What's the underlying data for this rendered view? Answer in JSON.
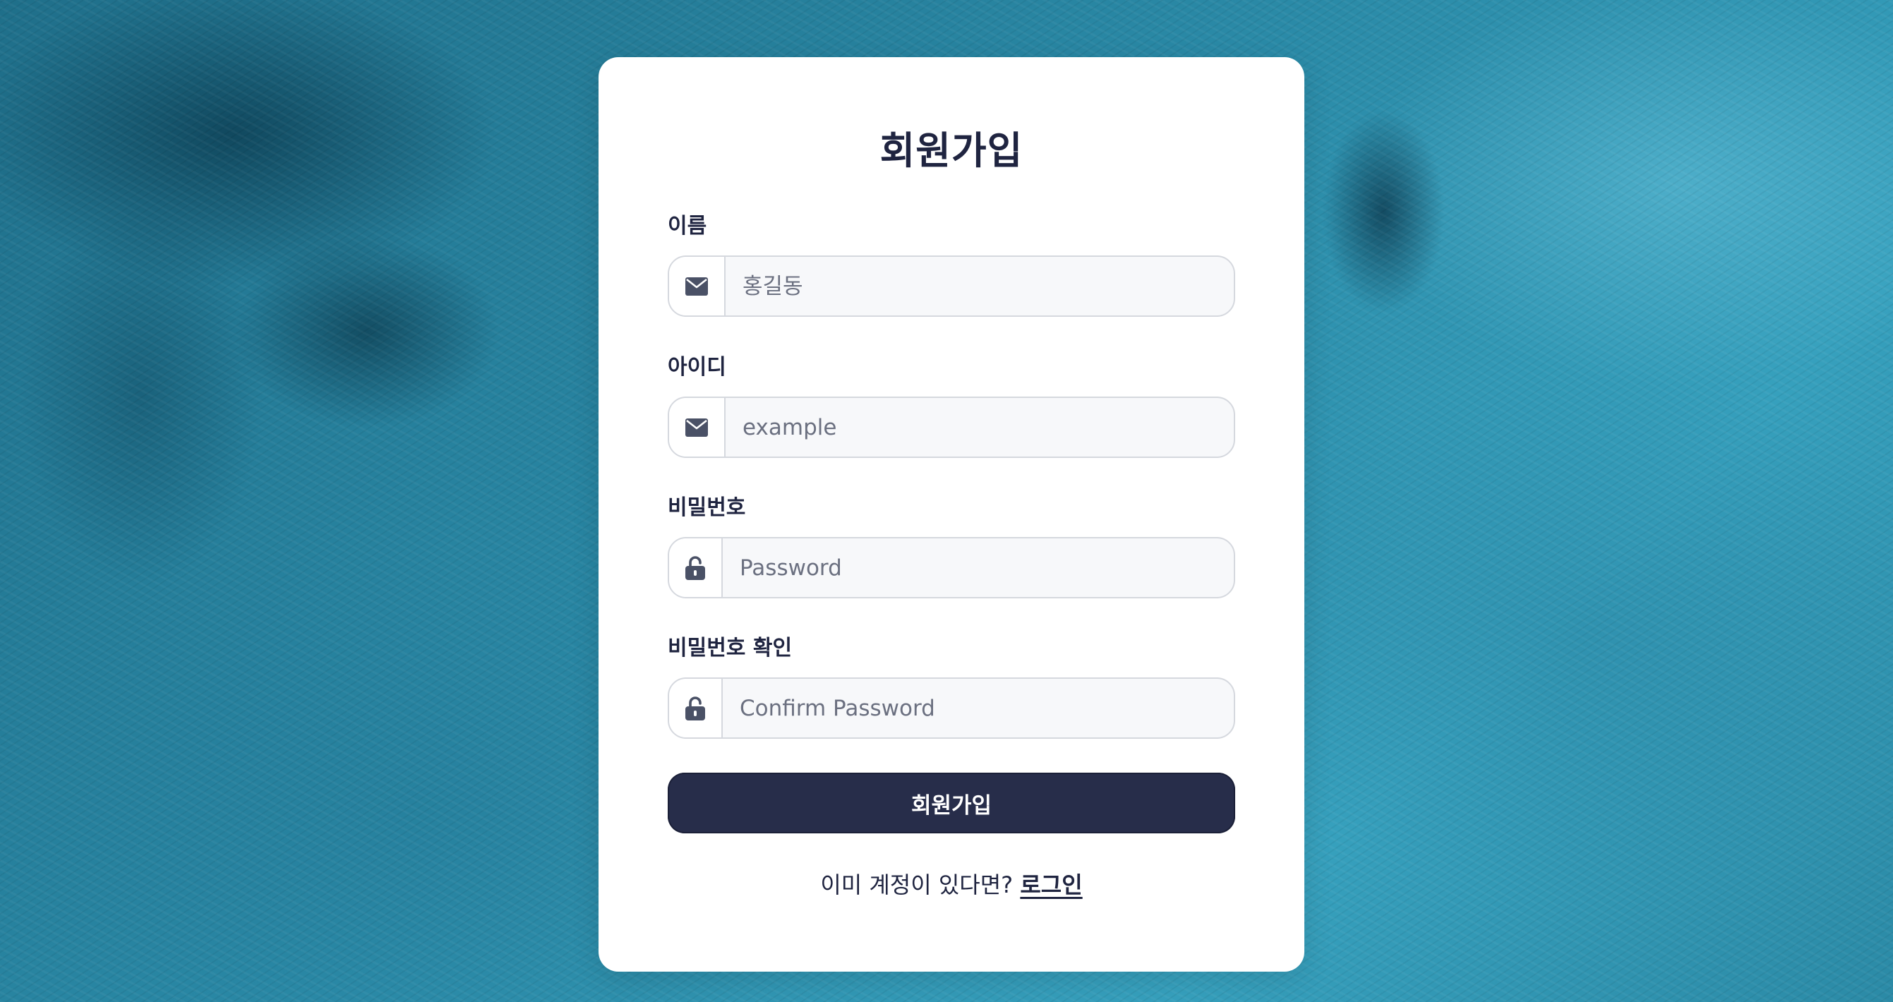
{
  "form": {
    "title": "회원가입",
    "fields": [
      {
        "label": "이름",
        "icon": "envelope-icon",
        "value": "",
        "placeholder": "홍길동"
      },
      {
        "label": "아이디",
        "icon": "envelope-icon",
        "value": "",
        "placeholder": "example"
      },
      {
        "label": "비밀번호",
        "icon": "unlock-icon",
        "value": "",
        "placeholder": "Password"
      },
      {
        "label": "비밀번호 확인",
        "icon": "unlock-icon",
        "value": "",
        "placeholder": "Confirm Password"
      }
    ],
    "submit_label": "회원가입"
  },
  "footer": {
    "prompt": "이미 계정이 있다면?",
    "login_link": "로그인"
  },
  "colors": {
    "primary": "#272d4a",
    "text": "#1f2440",
    "icon": "#4a5166",
    "input_bg": "#f7f8fa",
    "border": "#d5d8de"
  }
}
